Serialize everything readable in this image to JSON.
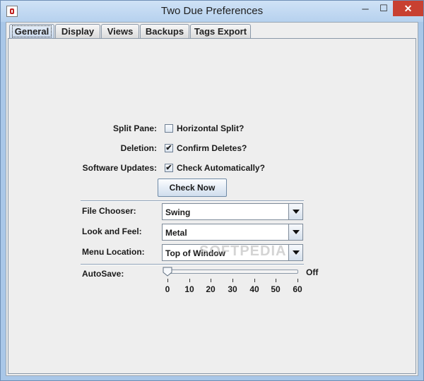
{
  "window": {
    "title": "Two Due Preferences",
    "min_glyph": "─",
    "max_glyph": "☐",
    "close_glyph": "✕"
  },
  "tabs": [
    {
      "label": "General",
      "active": true
    },
    {
      "label": "Display",
      "active": false
    },
    {
      "label": "Views",
      "active": false
    },
    {
      "label": "Backups",
      "active": false
    },
    {
      "label": "Tags Export",
      "active": false
    }
  ],
  "general": {
    "split_pane": {
      "label": "Split Pane:",
      "option": "Horizontal Split?",
      "checked": false
    },
    "deletion": {
      "label": "Deletion:",
      "option": "Confirm Deletes?",
      "checked": true
    },
    "software_updates": {
      "label": "Software Updates:",
      "option": "Check Automatically?",
      "checked": true
    },
    "check_now_label": "Check Now",
    "file_chooser": {
      "label": "File Chooser:",
      "value": "Swing"
    },
    "look_and_feel": {
      "label": "Look and Feel:",
      "value": "Metal"
    },
    "menu_location": {
      "label": "Menu Location:",
      "value": "Top of Window"
    },
    "autosave": {
      "label": "AutoSave:",
      "value_label": "Off",
      "min": 0,
      "max": 60,
      "value": 0,
      "ticks": [
        "0",
        "10",
        "20",
        "30",
        "40",
        "50",
        "60"
      ]
    }
  },
  "watermark": "SOFTPEDIA",
  "check_glyph": "✔"
}
